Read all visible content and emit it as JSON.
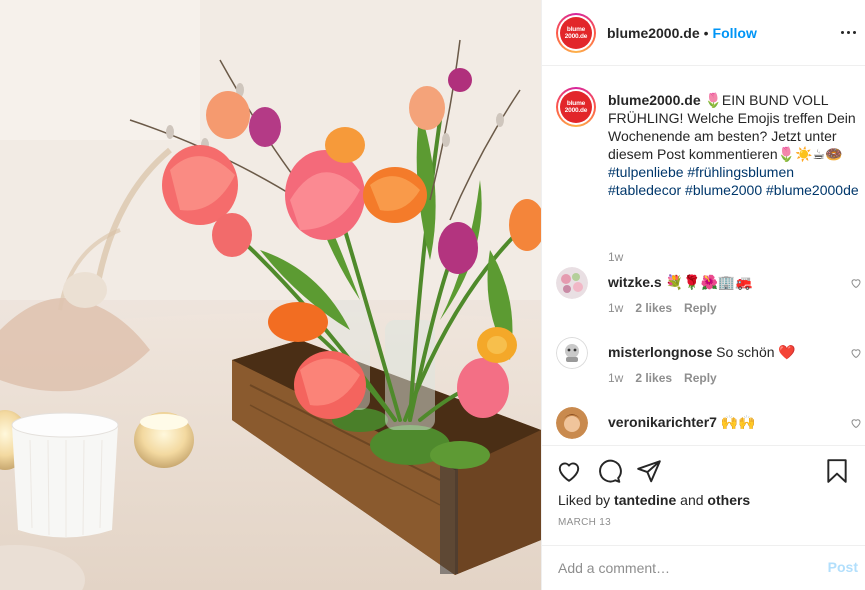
{
  "account": {
    "username": "blume2000.de",
    "avatar_text": "blume 2000.de",
    "follow_label": "Follow",
    "separator": "•"
  },
  "caption": {
    "username": "blume2000.de",
    "text": "🌷EIN BUND VOLL FRÜHLING! Welche Emojis treffen Dein Wochenende am besten? Jetzt unter diesem Post kommentieren🌷☀️☕🍩",
    "hashtags": "#tulpenliebe #frühlingsblumen #tabledecor #blume2000 #blume2000de",
    "time": "1w"
  },
  "comments": [
    {
      "username": "witzke.s",
      "text": "💐🌹🌺🏢🚒",
      "time": "1w",
      "likes": "2 likes",
      "reply": "Reply"
    },
    {
      "username": "misterlongnose",
      "text": "So schön ❤️",
      "time": "1w",
      "likes": "2 likes",
      "reply": "Reply"
    },
    {
      "username": "veronikarichter7",
      "text": "🙌🙌",
      "time": "",
      "likes": "",
      "reply": ""
    }
  ],
  "actions": {
    "liked_prefix": "Liked by",
    "liked_user": "tantedine",
    "liked_and": "and",
    "liked_others": "others",
    "date": "MARCH 13"
  },
  "add_comment": {
    "placeholder": "Add a comment…",
    "post_label": "Post"
  },
  "colors": {
    "link": "#0095f6",
    "hashtag": "#00376b",
    "muted": "#8e8e8e",
    "brand_red": "#e2262a"
  },
  "icons": [
    "more-options-icon",
    "heart-icon",
    "comment-icon",
    "share-icon",
    "bookmark-icon"
  ]
}
